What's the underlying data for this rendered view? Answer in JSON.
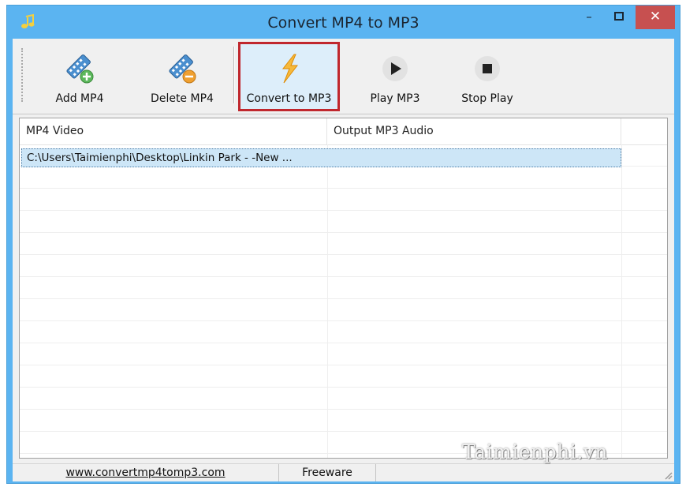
{
  "window": {
    "title": "Convert MP4 to MP3",
    "minimize_glyph": "–",
    "maximize_glyph": "▫",
    "close_glyph": "✕",
    "app_icon": "music-note-icon"
  },
  "toolbar": {
    "buttons": [
      {
        "label": "Add MP4",
        "icon": "film-add-icon"
      },
      {
        "label": "Delete MP4",
        "icon": "film-delete-icon"
      },
      {
        "label": "Convert to MP3",
        "icon": "lightning-icon",
        "highlighted": true
      },
      {
        "label": "Play MP3",
        "icon": "play-icon"
      },
      {
        "label": "Stop Play",
        "icon": "stop-icon"
      }
    ]
  },
  "list": {
    "columns": [
      "MP4 Video",
      "Output MP3 Audio"
    ],
    "rows": [
      {
        "video": "C:\\Users\\Taimienphi\\Desktop\\Linkin Park - -New ...",
        "audio": "",
        "selected": true
      }
    ]
  },
  "statusbar": {
    "website": "www.convertmp4tomp3.com",
    "license": "Freeware"
  },
  "watermark": "Taimienphi.vn",
  "colors": {
    "titlebar": "#5bb4f1",
    "close_button": "#c75050",
    "highlight_border": "#c0272d",
    "selection": "#cde6f7"
  }
}
